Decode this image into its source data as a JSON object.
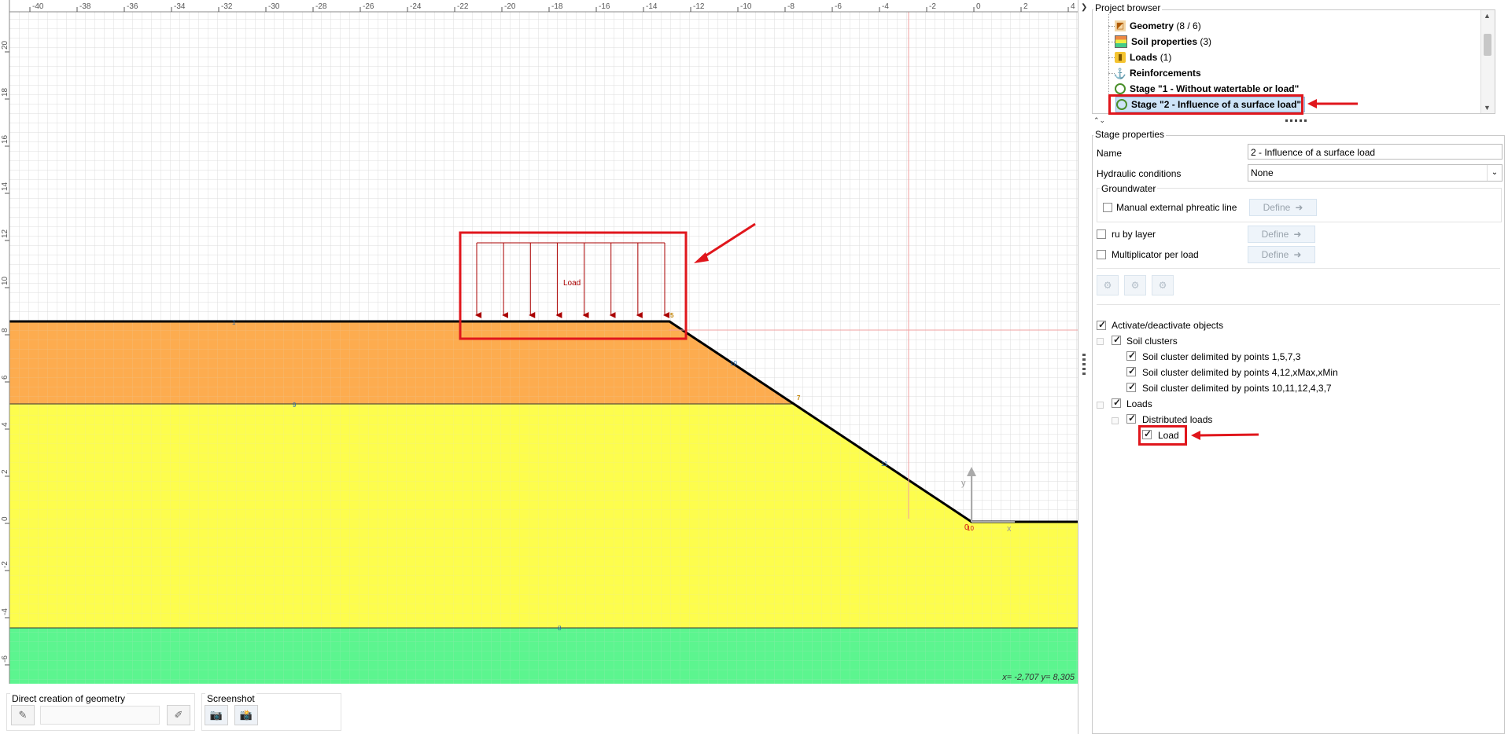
{
  "canvas": {
    "x_ticks": [
      "-40",
      "-38",
      "-36",
      "-34",
      "-32",
      "-30",
      "-28",
      "-26",
      "-24",
      "-22",
      "-20",
      "-18",
      "-16",
      "-14",
      "-12",
      "-10",
      "-8",
      "-6",
      "-4",
      "-2",
      "0",
      "2",
      "4"
    ],
    "y_ticks": [
      "20",
      "18",
      "16",
      "14",
      "12",
      "10",
      "8",
      "6",
      "4",
      "2",
      "0",
      "-2",
      "-4",
      "-6"
    ],
    "point_labels": [
      "1",
      "5",
      "10",
      "7",
      "9",
      "11",
      "10",
      "8"
    ],
    "load_label": "Load",
    "axis_y_label": "y",
    "axis_x_label": "x",
    "origin_label": "0",
    "coord_readout": "x= -2,707 y= 8,305",
    "colors": {
      "top_layer": "#fdac4f",
      "middle_layer": "#fdfd4d",
      "bottom_layer": "#5cf58f",
      "load_arrows": "#aa0000",
      "annotation": "#e0161c"
    }
  },
  "bottom_bar": {
    "direct_creation_title": "Direct creation of geometry",
    "screenshot_title": "Screenshot"
  },
  "project_browser": {
    "title": "Project browser",
    "items": [
      {
        "label": "Geometry",
        "count": "(8 / 6)",
        "icon": "geometry-icon"
      },
      {
        "label": "Soil properties",
        "count": "(3)",
        "icon": "soil-properties-icon"
      },
      {
        "label": "Loads",
        "count": "(1)",
        "icon": "loads-icon"
      },
      {
        "label": "Reinforcements",
        "count": "",
        "icon": "anchor-icon"
      },
      {
        "label": "Stage \"1 - Without watertable or load\"",
        "count": "",
        "icon": "stage-icon"
      },
      {
        "label": "Stage \"2 - Influence of a surface load\"",
        "count": "",
        "icon": "stage-icon"
      }
    ]
  },
  "stage_properties": {
    "title": "Stage properties",
    "name_label": "Name",
    "name_value": "2 - Influence of a surface load",
    "hydraulic_label": "Hydraulic conditions",
    "hydraulic_value": "None",
    "groundwater_title": "Groundwater",
    "manual_phreatic_label": "Manual external phreatic line",
    "ru_layer_label": "ru by layer",
    "multiplicator_label": "Multiplicator per load",
    "define_label": "Define",
    "activate_label": "Activate/deactivate objects",
    "soil_clusters_label": "Soil clusters",
    "cluster_1": "Soil cluster delimited by points 1,5,7,3",
    "cluster_2": "Soil cluster delimited by points 4,12,xMax,xMin",
    "cluster_3": "Soil cluster delimited by points 10,11,12,4,3,7",
    "loads_label": "Loads",
    "distributed_loads_label": "Distributed loads",
    "load_item_label": "Load"
  }
}
